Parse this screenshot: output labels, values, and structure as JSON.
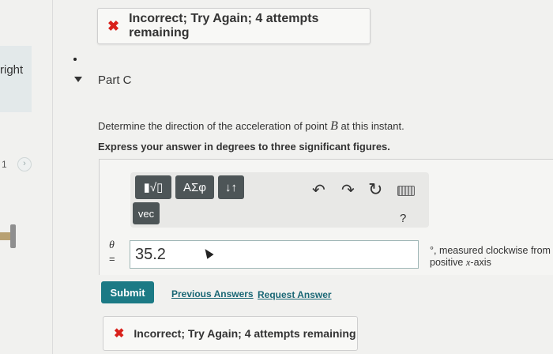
{
  "sidebar": {
    "label": "right",
    "step_number": "1",
    "chevron": "›"
  },
  "feedback_top": {
    "icon": "x-icon",
    "text": "Incorrect; Try Again; 4 attempts remaining"
  },
  "part": {
    "title": "Part C"
  },
  "question": {
    "prefix": "Determine the direction of the acceleration of point ",
    "variable": "B",
    "suffix": " at this instant.",
    "instruction": "Express your answer in degrees to three significant figures."
  },
  "toolbar": {
    "templates": "▮√▯",
    "greek": "ΑΣφ",
    "arrows": "↓↑",
    "vec": "vec",
    "undo": "↶",
    "redo": "↷",
    "reset": "↻",
    "help": "?"
  },
  "answer": {
    "variable": "θ",
    "equals": "=",
    "value": "35.2",
    "units_line1": "°, measured clockwise from",
    "units_line2_prefix": "positive ",
    "units_line2_var": "x",
    "units_line2_suffix": "-axis"
  },
  "actions": {
    "submit": "Submit",
    "previous_answers": "Previous Answers",
    "request_answer": "Request Answer"
  },
  "feedback_bottom": {
    "icon": "x-icon",
    "text": "Incorrect; Try Again; 4 attempts remaining"
  },
  "colors": {
    "error": "#d9211b",
    "submit": "#1c7a85",
    "link": "#1a6775"
  }
}
